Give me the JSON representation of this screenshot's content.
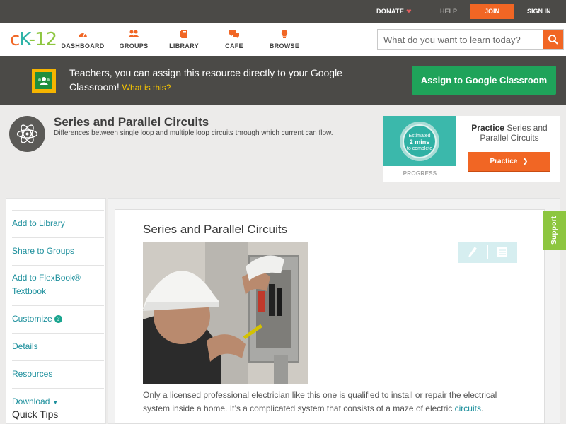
{
  "topbar": {
    "donate": "DONATE",
    "help": "HELP",
    "join": "JOIN",
    "signin": "SIGN IN"
  },
  "logo": {
    "c": "c",
    "k": "K",
    "n": "-12"
  },
  "nav": {
    "items": [
      {
        "label": "DASHBOARD",
        "icon": "dashboard-icon"
      },
      {
        "label": "GROUPS",
        "icon": "groups-icon"
      },
      {
        "label": "LIBRARY",
        "icon": "library-icon"
      },
      {
        "label": "CAFE",
        "icon": "cafe-icon"
      },
      {
        "label": "BROWSE",
        "icon": "browse-icon"
      }
    ],
    "search_placeholder": "What do you want to learn today?"
  },
  "banner": {
    "message": "Teachers, you can assign this resource directly to your Google Classroom!",
    "what": "What is this?",
    "button": "Assign to Google Classroom"
  },
  "concept": {
    "title": "Series and Parallel Circuits",
    "subtitle": "Differences between single loop and multiple loop circuits through which current can flow."
  },
  "practice": {
    "estimated": "Estimated",
    "mins": "2 mins",
    "complete": "to complete",
    "progress": "PROGRESS",
    "title_bold": "Practice",
    "title_rest": "Series and Parallel Circuits",
    "button": "Practice"
  },
  "sidebar": {
    "items": [
      {
        "label": "Add to Library"
      },
      {
        "label": "Share to Groups"
      },
      {
        "label": "Add to FlexBook® Textbook"
      },
      {
        "label": "Customize"
      },
      {
        "label": "Details"
      },
      {
        "label": "Resources"
      },
      {
        "label": "Download"
      }
    ],
    "quick_tips": "Quick Tips"
  },
  "article": {
    "title": "Series and Parallel Circuits",
    "body": "Only a licensed professional electrician like this one is qualified to install or repair the electrical system inside a home. It’s a complicated system that consists of a maze of electric",
    "link": "circuits",
    "end": "."
  },
  "support": "Support",
  "colors": {
    "accent_orange": "#f16624",
    "teal": "#2db3a7",
    "green": "#8dc63f",
    "dark_bar": "#4b4a47",
    "classroom_green": "#1fa35a"
  }
}
